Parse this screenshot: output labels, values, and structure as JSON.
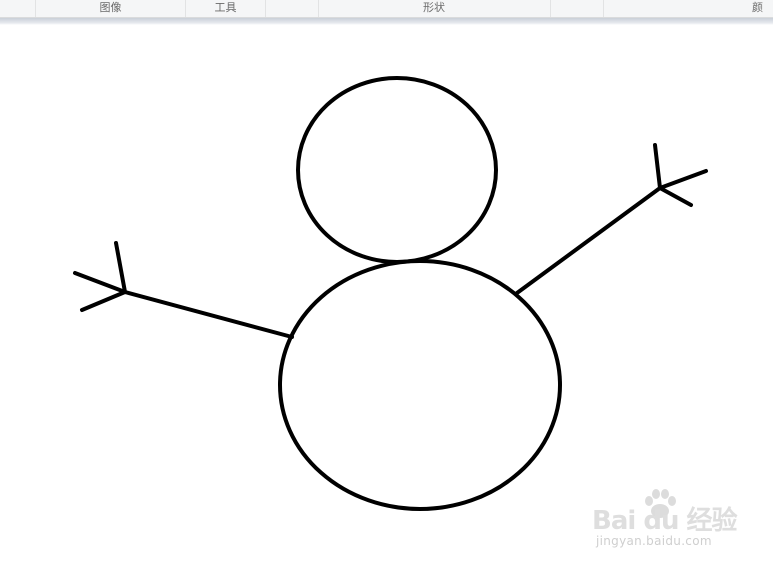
{
  "ribbon": {
    "groups": [
      {
        "label": "图像"
      },
      {
        "label": "工具"
      },
      {
        "label": "形状"
      },
      {
        "label": "颜"
      }
    ]
  },
  "canvas": {
    "background": "#ffffff",
    "stroke_color": "#000000",
    "drawing": "snowman"
  },
  "watermark": {
    "logo": "Bai du 经验",
    "url": "jingyan.baidu.com",
    "icon": "paw-icon"
  }
}
